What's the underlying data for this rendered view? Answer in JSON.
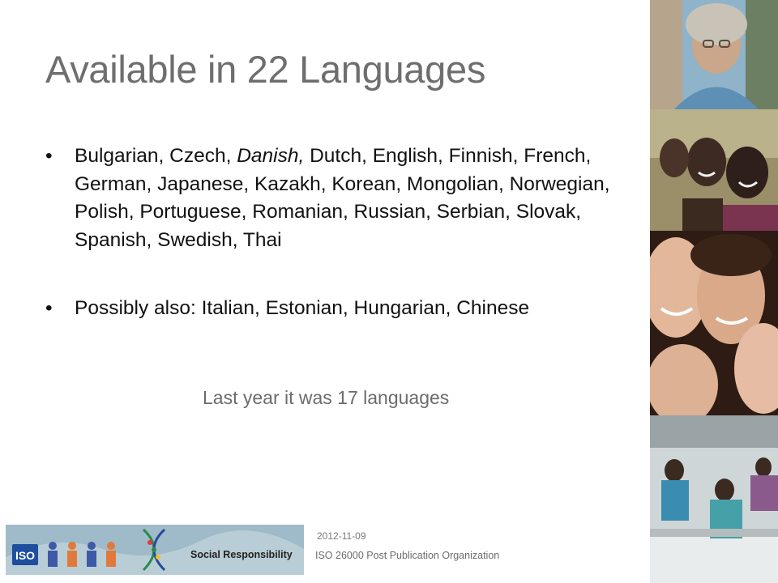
{
  "slide": {
    "title": "Available in 22 Languages",
    "bullets": [
      {
        "parts": [
          {
            "text": "Bulgarian, Czech, "
          },
          {
            "text": "Danish,",
            "italic": true
          },
          {
            "text": " Dutch, English, Finnish, French, German, Japanese, Kazakh, Korean, Mongolian, Norwegian, Polish, Portuguese, Romanian, Russian, Serbian, Slovak, Spanish, Swedish, Thai"
          }
        ]
      },
      {
        "parts": [
          {
            "text": "Possibly also: Italian, Estonian, Hungarian, Chinese"
          }
        ]
      }
    ],
    "bullet_symbol": "•",
    "note": "Last year it was 17 languages"
  },
  "footer": {
    "date": "2012-11-09",
    "organization": "ISO 26000 Post Publication Organization",
    "logo": {
      "iso_text": "ISO",
      "tagline": "Social Responsibility"
    }
  },
  "photos": [
    "older-woman-portrait",
    "two-children",
    "group-of-smiling-teens",
    "textile-workers"
  ]
}
